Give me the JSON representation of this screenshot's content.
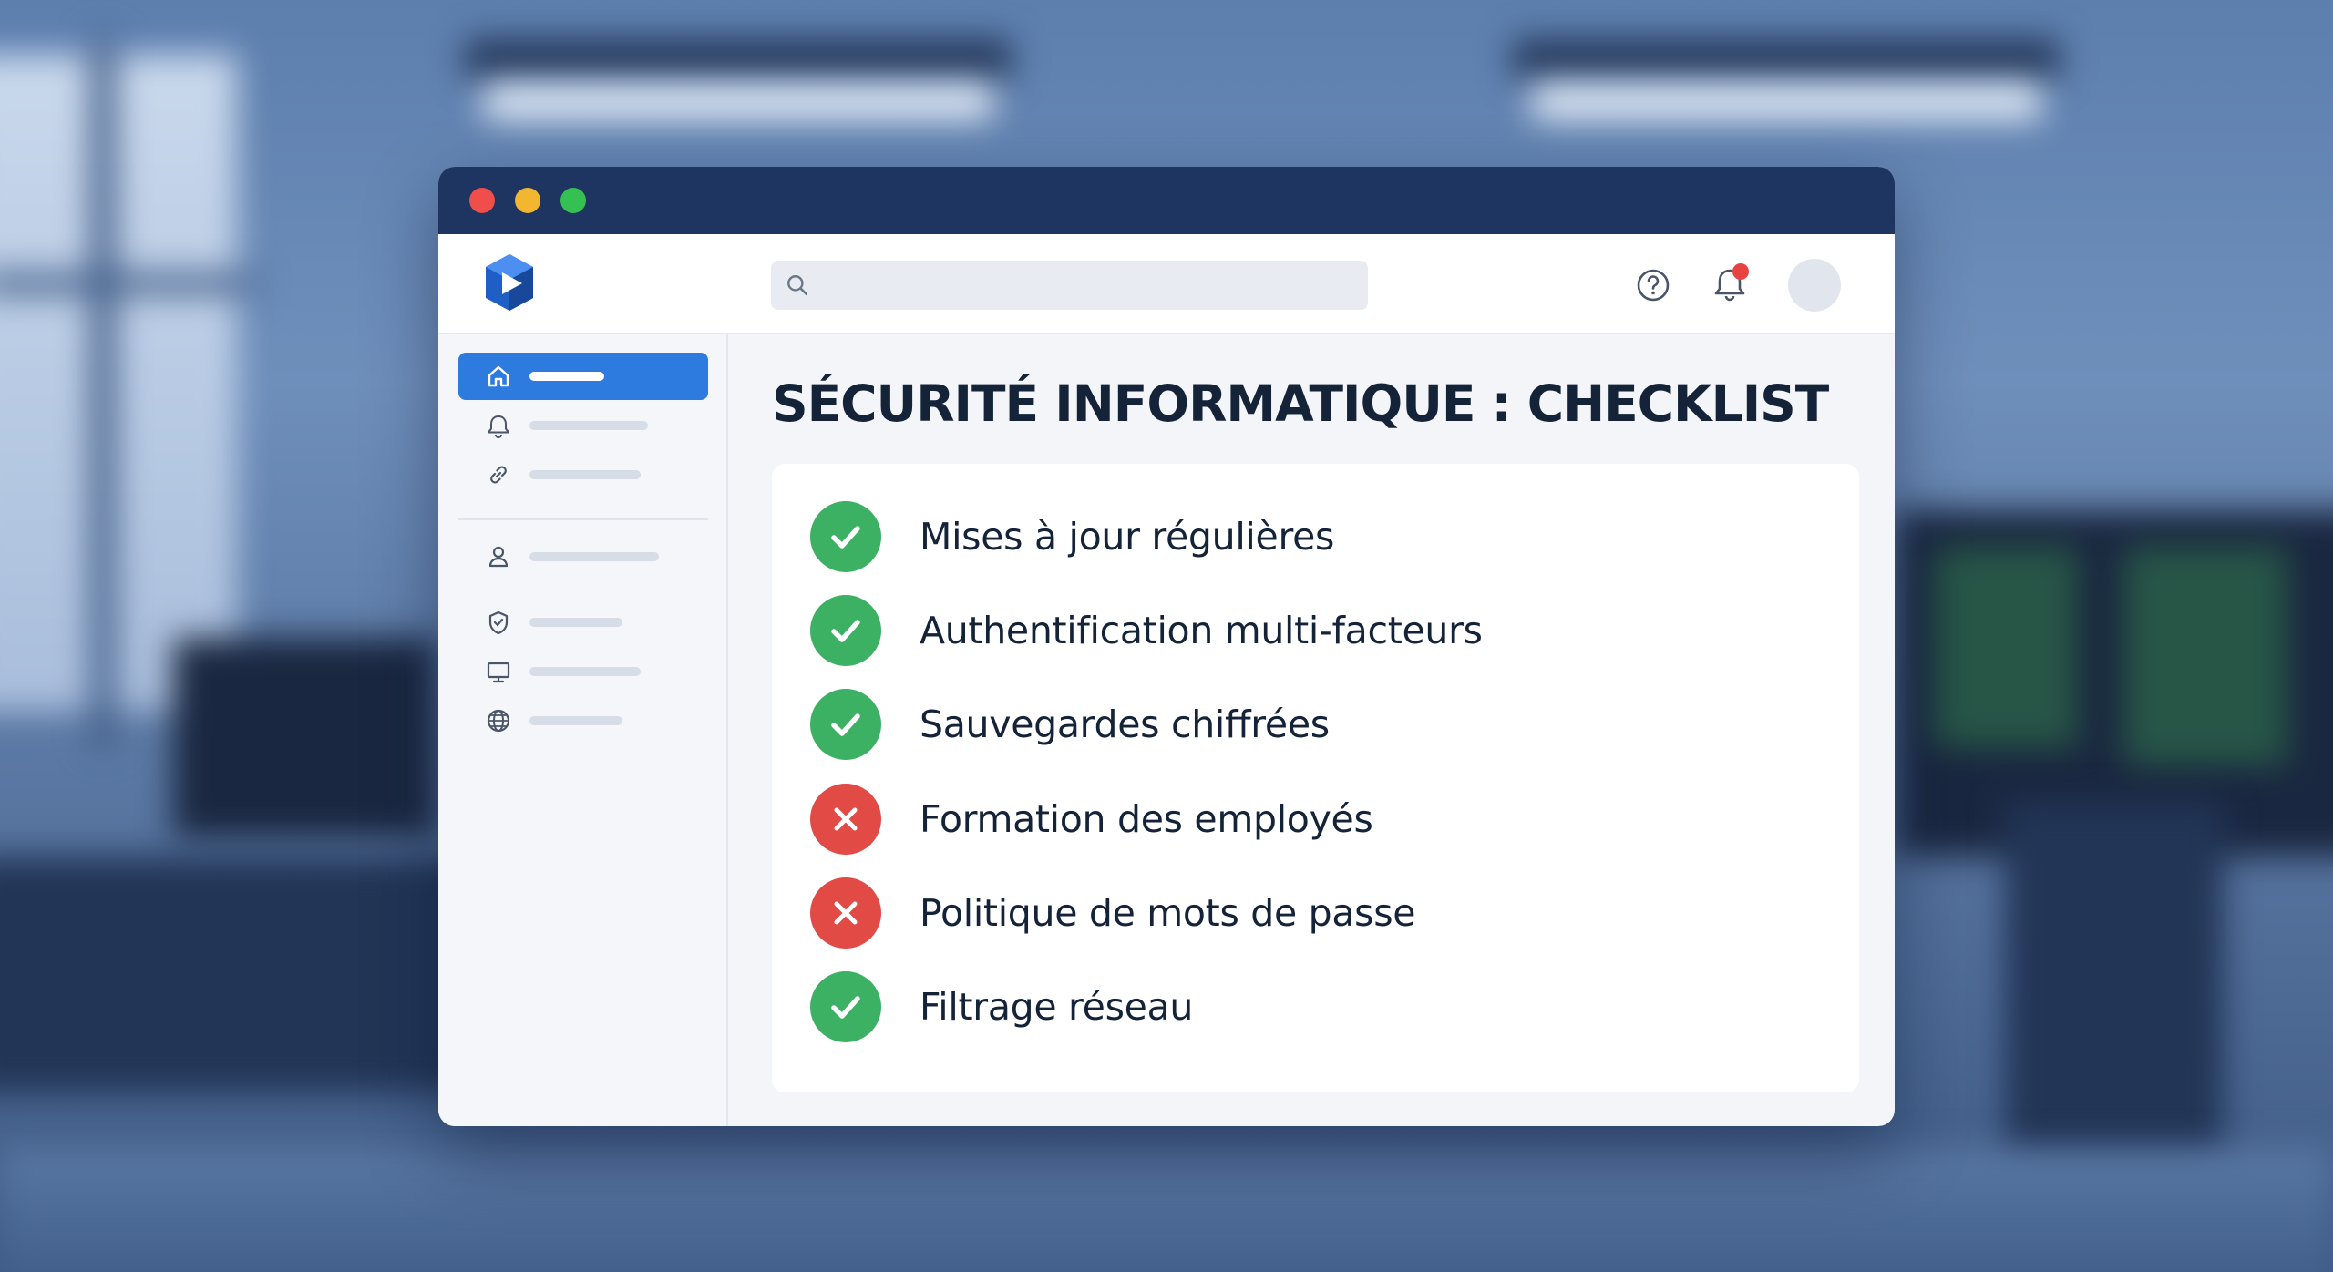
{
  "window": {
    "controls": [
      "close",
      "minimize",
      "maximize"
    ]
  },
  "header": {
    "logo_icon": "shield-play-logo-icon",
    "search": {
      "value": "",
      "placeholder": ""
    },
    "help_icon": "help-circle-icon",
    "notifications_icon": "bell-icon",
    "notifications_badge": true
  },
  "sidebar": {
    "items": [
      {
        "icon": "home-icon",
        "active": true
      },
      {
        "icon": "bell-icon",
        "active": false
      },
      {
        "icon": "link-icon",
        "active": false
      },
      {
        "icon": "user-icon",
        "active": false
      },
      {
        "icon": "shield-icon",
        "active": false
      },
      {
        "icon": "monitor-icon",
        "active": false
      },
      {
        "icon": "globe-icon",
        "active": false
      }
    ]
  },
  "main": {
    "title": "SÉCURITÉ INFORMATIQUE : CHECKLIST",
    "checklist": [
      {
        "label": "Mises à jour régulières",
        "status": "ok"
      },
      {
        "label": "Authentification multi-facteurs",
        "status": "ok"
      },
      {
        "label": "Sauvegardes chiffrées",
        "status": "ok"
      },
      {
        "label": "Formation des employés",
        "status": "fail"
      },
      {
        "label": "Politique de mots de passe",
        "status": "fail"
      },
      {
        "label": "Filtrage réseau",
        "status": "ok"
      }
    ]
  },
  "colors": {
    "titlebar": "#1d3560",
    "accent": "#2e7be0",
    "ok": "#3cb063",
    "fail": "#e24a45",
    "badge": "#e84343"
  }
}
